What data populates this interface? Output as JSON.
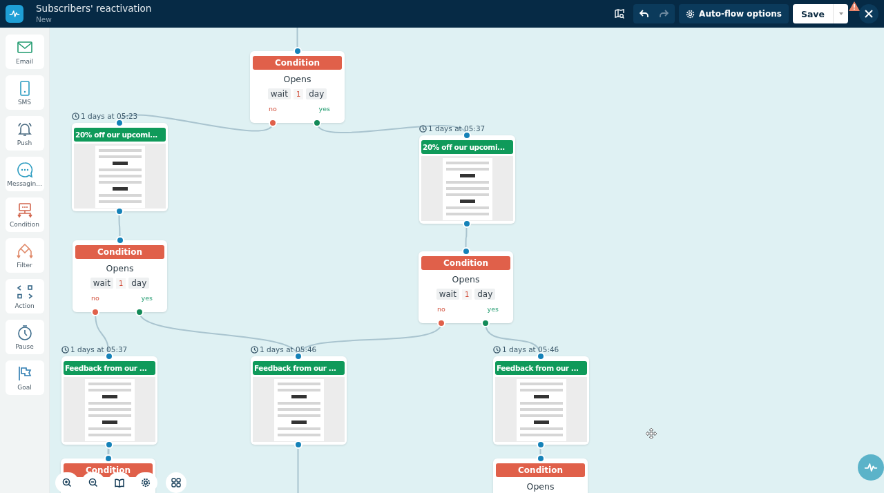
{
  "header": {
    "title": "Subscribers' reactivation",
    "subtitle": "New",
    "options_button": "Auto-flow options",
    "save_button": "Save"
  },
  "sidebar": {
    "items": [
      {
        "kind": "email",
        "label": "Email"
      },
      {
        "kind": "sms",
        "label": "SMS"
      },
      {
        "kind": "push",
        "label": "Push"
      },
      {
        "kind": "messaging",
        "label": "Messagin..."
      },
      {
        "kind": "condition",
        "label": "Condition"
      },
      {
        "kind": "filter",
        "label": "Filter"
      },
      {
        "kind": "action",
        "label": "Action"
      },
      {
        "kind": "pause",
        "label": "Pause"
      },
      {
        "kind": "goal",
        "label": "Goal"
      }
    ]
  },
  "canvas": {
    "nodes": [
      {
        "kind": "condition",
        "title": "Condition",
        "event": "Opens",
        "wait": {
          "label": "wait",
          "value": "1",
          "unit": "day"
        },
        "no": "no",
        "yes": "yes"
      },
      {
        "kind": "email",
        "timing": "1 days at 05:23",
        "title": "20% off our upcomi..."
      },
      {
        "kind": "email",
        "timing": "1 days at 05:37",
        "title": "20% off our upcomi..."
      },
      {
        "kind": "condition",
        "title": "Condition",
        "event": "Opens",
        "wait": {
          "label": "wait",
          "value": "1",
          "unit": "day"
        },
        "no": "no",
        "yes": "yes"
      },
      {
        "kind": "condition",
        "title": "Condition",
        "event": "Opens",
        "wait": {
          "label": "wait",
          "value": "1",
          "unit": "day"
        },
        "no": "no",
        "yes": "yes"
      },
      {
        "kind": "email",
        "timing": "1 days at 05:37",
        "title": "Feedback from our ..."
      },
      {
        "kind": "email",
        "timing": "1 days at 05:46",
        "title": "Feedback from our ..."
      },
      {
        "kind": "email",
        "timing": "1 days at 05:46",
        "title": "Feedback from our ..."
      },
      {
        "kind": "condition",
        "title": "Condition"
      },
      {
        "kind": "condition",
        "title": "Condition",
        "event": "Opens"
      }
    ]
  }
}
